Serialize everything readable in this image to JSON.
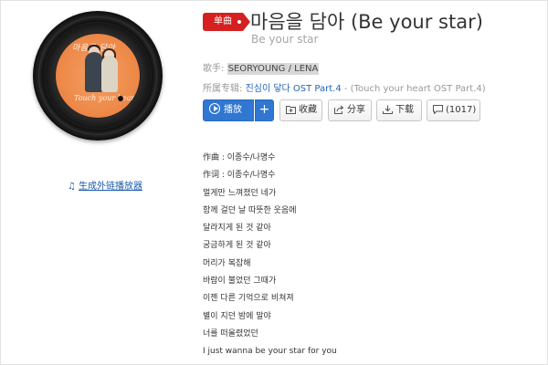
{
  "cover": {
    "title_script": "마음을 담아",
    "subtitle_script": "Touch your heart"
  },
  "external_player_link": "生成外链播放器",
  "badge": "单曲",
  "title": "마음을 담아 (Be your star)",
  "subtitle": "Be your star",
  "singer": {
    "label": "歌手:",
    "value": "SEORYOUNG / LENA"
  },
  "album": {
    "label": "所属专辑:",
    "link": "진심이 닿다 OST Part.4",
    "extra": " - (Touch your heart OST Part.4)"
  },
  "buttons": {
    "play": "播放",
    "add": "+",
    "collect": "收藏",
    "share": "分享",
    "download": "下载",
    "comments": "(1017)"
  },
  "lyrics": [
    "作曲 : 이종수/나명수",
    "作词 : 이종수/나명수",
    "멀게만 느껴졌던 네가",
    "함께 걸던 날 따뜻한 웃음에",
    "달라지게 된 것 같아",
    "궁금하게 된 것 같아",
    "머리가 복잡해",
    "바람이 불었던 그때가",
    "이젠 다른 기억으로 비쳐져",
    "별이 지던 밤에 말야",
    "너를 떠올렸었던",
    "I just wanna be your star for you"
  ],
  "colors": {
    "accent_blue": "#2f77d0",
    "badge_red": "#d42020",
    "link_blue": "#2366b5"
  }
}
